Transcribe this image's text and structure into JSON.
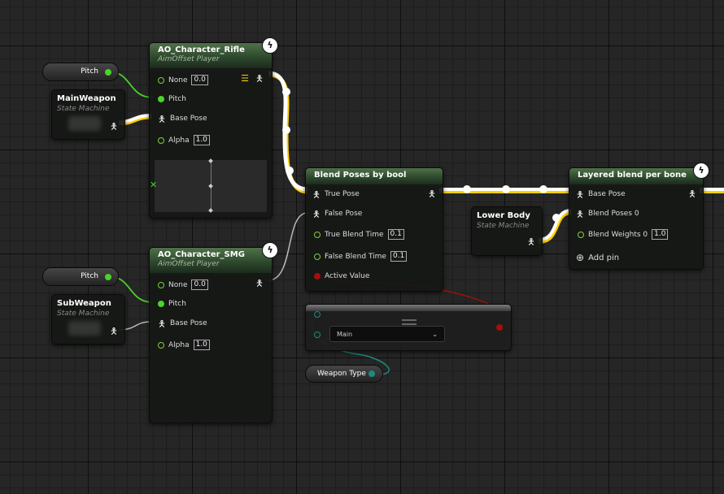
{
  "nodes": {
    "ao_rifle": {
      "title": "AO_Character_Rifle",
      "subtitle": "AimOffset Player",
      "pins": {
        "none_label": "None",
        "none_value": "0.0",
        "pitch": "Pitch",
        "base_pose": "Base Pose",
        "alpha": "Alpha",
        "alpha_value": "1.0"
      }
    },
    "ao_smg": {
      "title": "AO_Character_SMG",
      "subtitle": "AimOffset Player",
      "pins": {
        "none_label": "None",
        "none_value": "0.0",
        "pitch": "Pitch",
        "base_pose": "Base Pose",
        "alpha": "Alpha",
        "alpha_value": "1.0"
      }
    },
    "blend_bool": {
      "title": "Blend Poses by bool",
      "pins": {
        "true_pose": "True Pose",
        "false_pose": "False Pose",
        "true_blend_time": "True Blend Time",
        "true_blend_value": "0.1",
        "false_blend_time": "False Blend Time",
        "false_blend_value": "0.1",
        "active_value": "Active Value"
      }
    },
    "layered_blend": {
      "title": "Layered blend per bone",
      "pins": {
        "base_pose": "Base Pose",
        "blend_poses_0": "Blend Poses 0",
        "blend_weights_0": "Blend Weights 0",
        "blend_weights_value": "1.0",
        "add_pin": "Add pin"
      }
    },
    "main_weapon": {
      "title": "MainWeapon",
      "subtitle": "State Machine"
    },
    "sub_weapon": {
      "title": "SubWeapon",
      "subtitle": "State Machine"
    },
    "lower_body": {
      "title": "Lower Body",
      "subtitle": "State Machine"
    },
    "pitch_1": {
      "label": "Pitch"
    },
    "pitch_2": {
      "label": "Pitch"
    },
    "weapon_type": {
      "label": "Weapon Type"
    },
    "equal_node": {
      "selected": "Main"
    }
  },
  "icons": {
    "event": "lightning-bolt-icon",
    "pose": "person-pose-icon",
    "add": "plus-circle-icon",
    "dropdown": "chevron-down-icon"
  },
  "colors": {
    "pose_wire": "#ffffff",
    "float_wire": "#4ad32a",
    "bool_wire": "#a50f0f",
    "enum_wire": "#1e8a7e",
    "exec_accent": "#ffd000",
    "header_green": "#3d5c3a"
  }
}
